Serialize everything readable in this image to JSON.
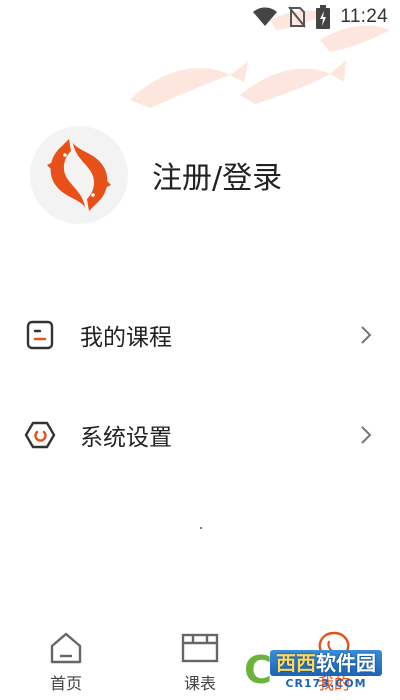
{
  "status_bar": {
    "time": "11:24",
    "icons": [
      "wifi-icon",
      "no-sim-icon",
      "battery-charging-icon"
    ]
  },
  "profile": {
    "login_label": "注册/登录",
    "avatar_icon": "koi-logo-icon"
  },
  "menu": {
    "items": [
      {
        "label": "我的课程",
        "icon": "course-icon"
      },
      {
        "label": "系统设置",
        "icon": "settings-hexagon-icon"
      }
    ]
  },
  "bottom_nav": {
    "tabs": [
      {
        "label": "首页",
        "icon": "home-icon"
      },
      {
        "label": "课表",
        "icon": "timetable-icon"
      },
      {
        "label": "我的",
        "icon": "profile-koi-icon",
        "active": true
      }
    ]
  },
  "watermark": {
    "main_a": "西西",
    "main_b": "软件园",
    "sub": "CR173.COM"
  },
  "colors": {
    "accent": "#e8501a",
    "text": "#222222",
    "icon_dark": "#333333"
  }
}
